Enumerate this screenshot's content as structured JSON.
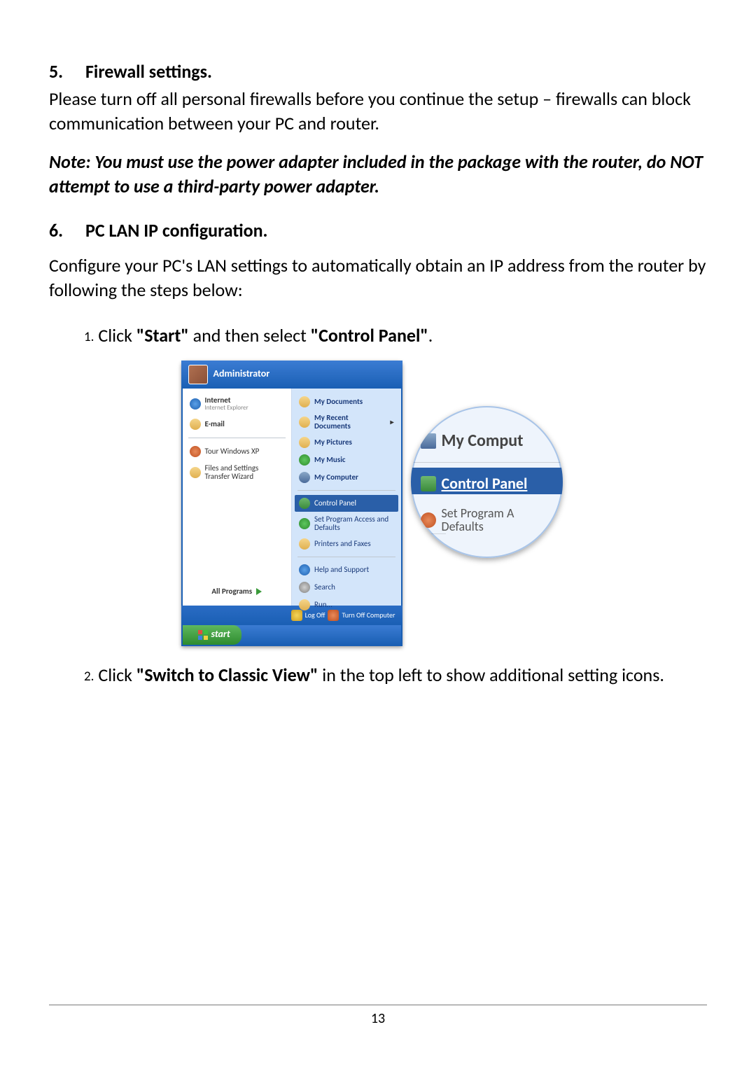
{
  "section5": {
    "number": "5.",
    "title": "Firewall settings.",
    "body": "Please turn off all personal firewalls before you continue the setup – firewalls can block communication between your PC and router.",
    "note": "Note: You must use the power adapter included in the package with the router, do NOT attempt to use a third-party power adapter."
  },
  "section6": {
    "number": "6.",
    "title": "PC LAN IP configuration.",
    "body": "Configure your PC's LAN settings to automatically obtain an IP address from the router by following the steps below:"
  },
  "steps": {
    "s1": {
      "num": "1.",
      "pre": "Click ",
      "b1": "\"Start\"",
      "mid": " and then select ",
      "b2": "\"Control Panel\"",
      "post": "."
    },
    "s2": {
      "num": "2.",
      "pre": "Click ",
      "b1": "\"Switch to Classic View\"",
      "post": " in the top left to show additional setting icons."
    }
  },
  "startmenu": {
    "user": "Administrator",
    "left": {
      "internet_title": "Internet",
      "internet_sub": "Internet Explorer",
      "email_title": "E-mail",
      "tour": "Tour Windows XP",
      "wizard": "Files and Settings Transfer Wizard",
      "all_programs": "All Programs"
    },
    "right": {
      "my_docs": "My Documents",
      "my_recent": "My Recent Documents",
      "my_pictures": "My Pictures",
      "my_music": "My Music",
      "my_computer": "My Computer",
      "control_panel": "Control Panel",
      "set_program": "Set Program Access and Defaults",
      "printers": "Printers and Faxes",
      "help": "Help and Support",
      "search": "Search",
      "run": "Run..."
    },
    "footer": {
      "log_off": "Log Off",
      "turn_off": "Turn Off Computer"
    },
    "taskbar_start": "start"
  },
  "magnified": {
    "my_computer": "My Comput",
    "control_panel": "Control Panel",
    "set_program_l1": "Set Program A",
    "set_program_l2": "Defaults"
  },
  "page_number": "13"
}
